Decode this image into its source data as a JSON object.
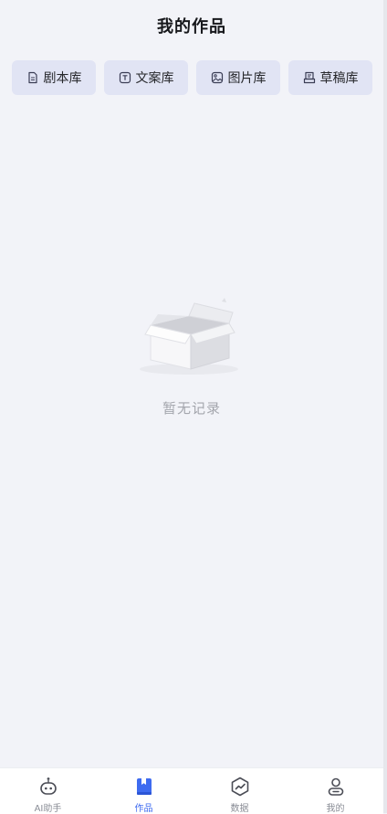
{
  "header": {
    "title": "我的作品"
  },
  "libraries": [
    {
      "label": "剧本库",
      "icon": "document-icon"
    },
    {
      "label": "文案库",
      "icon": "text-box-icon"
    },
    {
      "label": "图片库",
      "icon": "image-icon"
    },
    {
      "label": "草稿库",
      "icon": "draft-icon"
    }
  ],
  "empty_state": {
    "text": "暂无记录",
    "icon": "empty-box-illustration"
  },
  "tabbar": {
    "active_color": "#3e6bf0",
    "items": [
      {
        "label": "AI助手",
        "icon": "robot-icon",
        "active": false
      },
      {
        "label": "作品",
        "icon": "book-icon",
        "active": true
      },
      {
        "label": "数据",
        "icon": "chart-icon",
        "active": false
      },
      {
        "label": "我的",
        "icon": "user-icon",
        "active": false
      }
    ]
  }
}
